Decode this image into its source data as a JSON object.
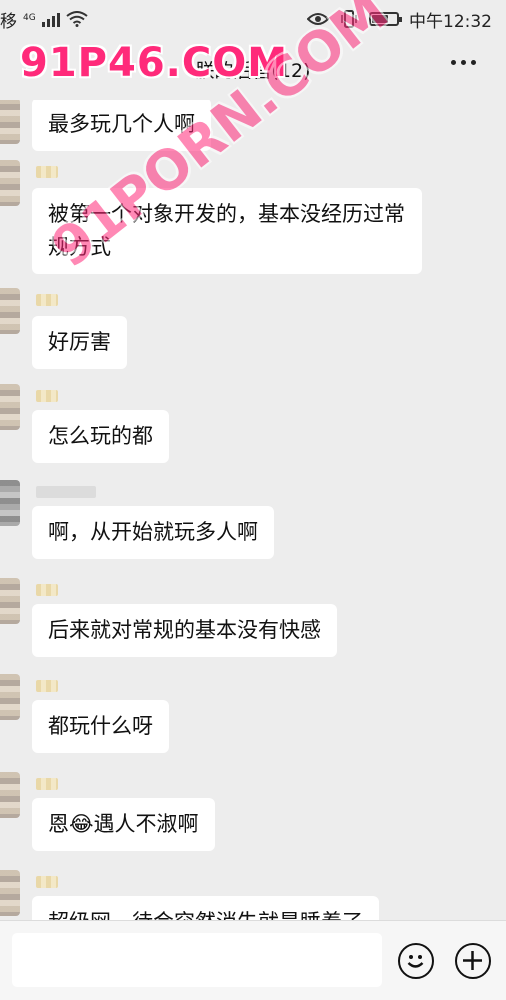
{
  "status_bar": {
    "carrier": "移",
    "network": "4G",
    "time": "中午12:32"
  },
  "header": {
    "chat_title": "朕的后宫(12)",
    "more_icon": "more-dots-icon"
  },
  "watermarks": {
    "top": "91P46.COM",
    "diagonal": "91PORN.COM"
  },
  "messages": [
    {
      "text": "最多玩几个人啊"
    },
    {
      "text": "被第一个对象开发的，基本没经历过常规方式"
    },
    {
      "text": "好厉害"
    },
    {
      "text": "怎么玩的都"
    },
    {
      "text": "啊，从开始就玩多人啊"
    },
    {
      "text": "后来就对常规的基本没有快感"
    },
    {
      "text": "都玩什么呀"
    },
    {
      "text": "恩😂遇人不淑啊"
    },
    {
      "text": "超级网，待会突然消失就是睡着了"
    }
  ],
  "input_bar": {
    "emoji_icon": "emoji-icon",
    "plus_icon": "plus-icon"
  }
}
